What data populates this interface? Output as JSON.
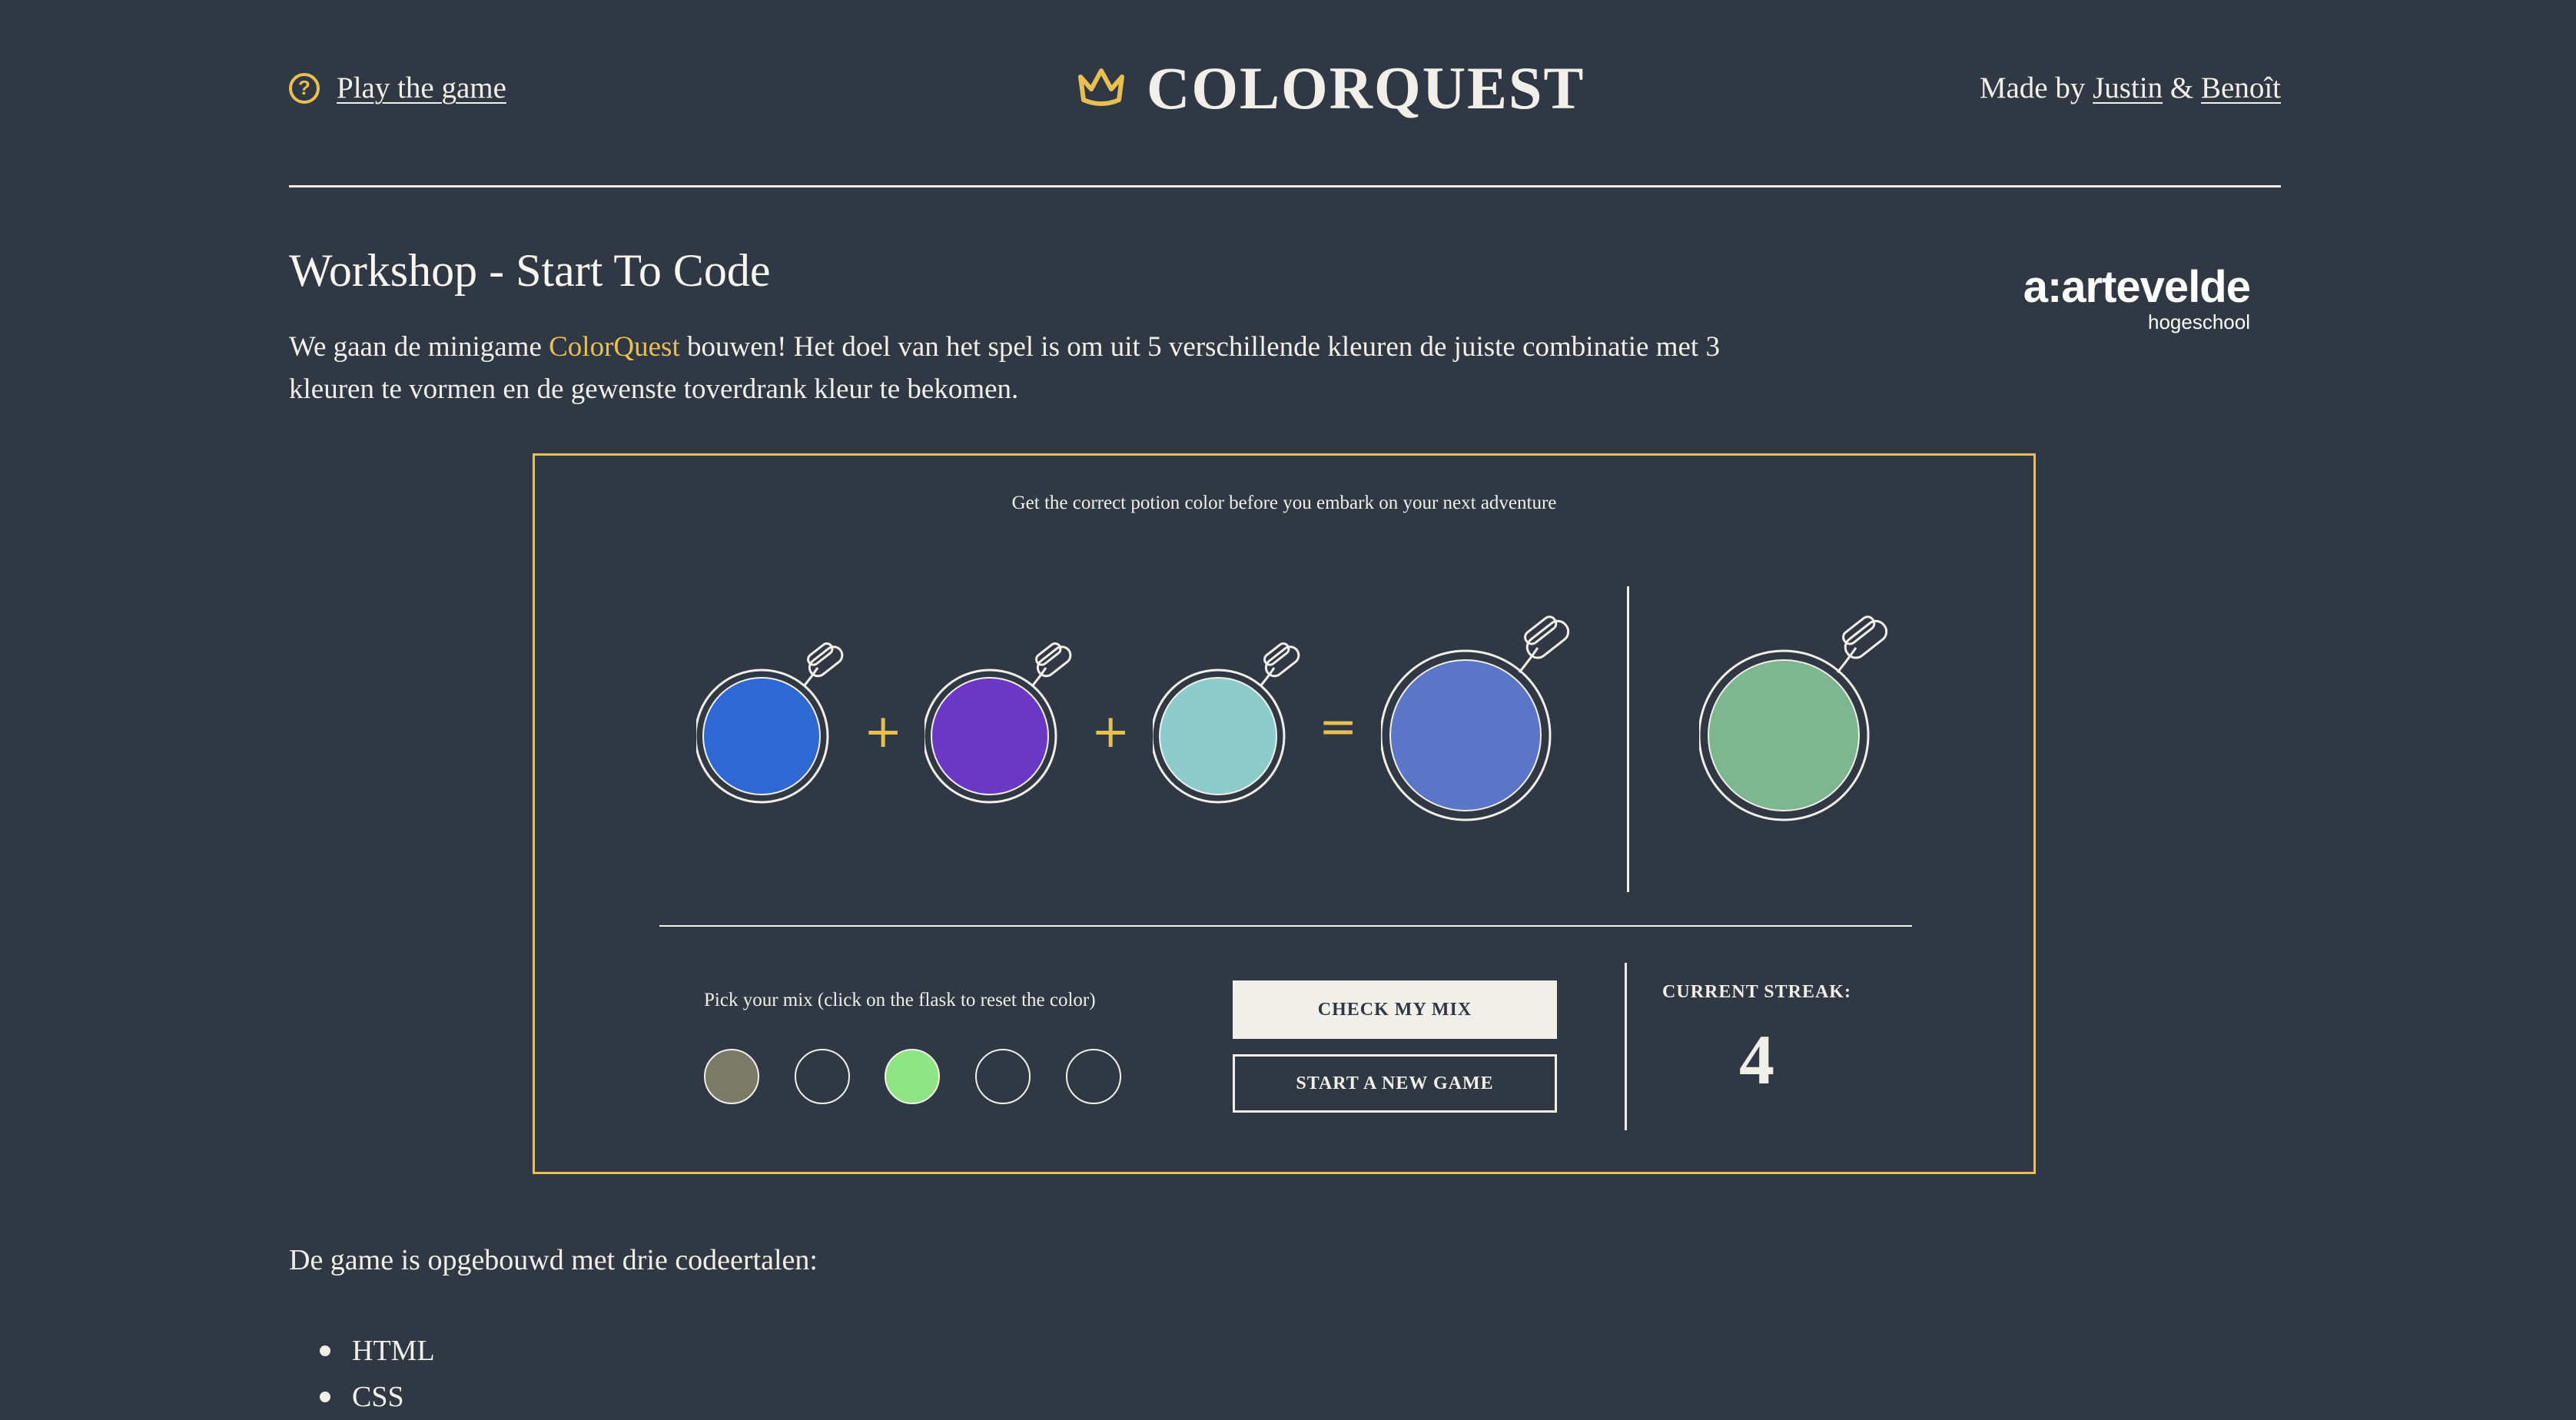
{
  "header": {
    "help_link": "Play the game",
    "logo_text": "COLORQUEST",
    "made_by_prefix": "Made by",
    "author1": "Justin",
    "amp": "&",
    "author2": "Benoît"
  },
  "workshop": {
    "title": "Workshop - Start To Code",
    "intro_before": "We gaan de minigame",
    "intro_highlight": "ColorQuest",
    "intro_after": "bouwen! Het doel van het spel is om uit 5 verschillende kleuren de juiste combinatie met 3 kleuren te vormen en de gewenste toverdrank kleur te bekomen."
  },
  "brand": {
    "main": "a:artevelde",
    "sub": "hogeschool"
  },
  "game": {
    "tagline": "Get the correct potion color before you embark on your next adventure",
    "flasks": [
      {
        "name": "mix-flask-1",
        "color": "#2f68d4"
      },
      {
        "name": "mix-flask-2",
        "color": "#6b37c5"
      },
      {
        "name": "mix-flask-3",
        "color": "#8ecccc"
      }
    ],
    "result_color": "#5b76c6",
    "target_color": "#7db690",
    "operators": [
      "+",
      "+",
      "="
    ],
    "pick_label": "Pick your mix (click on the flask to reset the color)",
    "palette": [
      {
        "name": "palette-color-1",
        "color": "#7a7a68"
      },
      {
        "name": "palette-color-2",
        "color": ""
      },
      {
        "name": "palette-color-3",
        "color": "#8de683"
      },
      {
        "name": "palette-color-4",
        "color": ""
      },
      {
        "name": "palette-color-5",
        "color": ""
      }
    ],
    "check_label": "Check my mix",
    "new_game_label": "Start a new game",
    "streak_label": "CURRENT STREAK:",
    "streak_value": "4"
  },
  "built": {
    "text": "De game is opgebouwd met drie codeertalen:",
    "languages": [
      "HTML",
      "CSS"
    ]
  },
  "colors": {
    "background": "#2f3843",
    "accent": "#e9bf52",
    "text": "#f1efea"
  }
}
